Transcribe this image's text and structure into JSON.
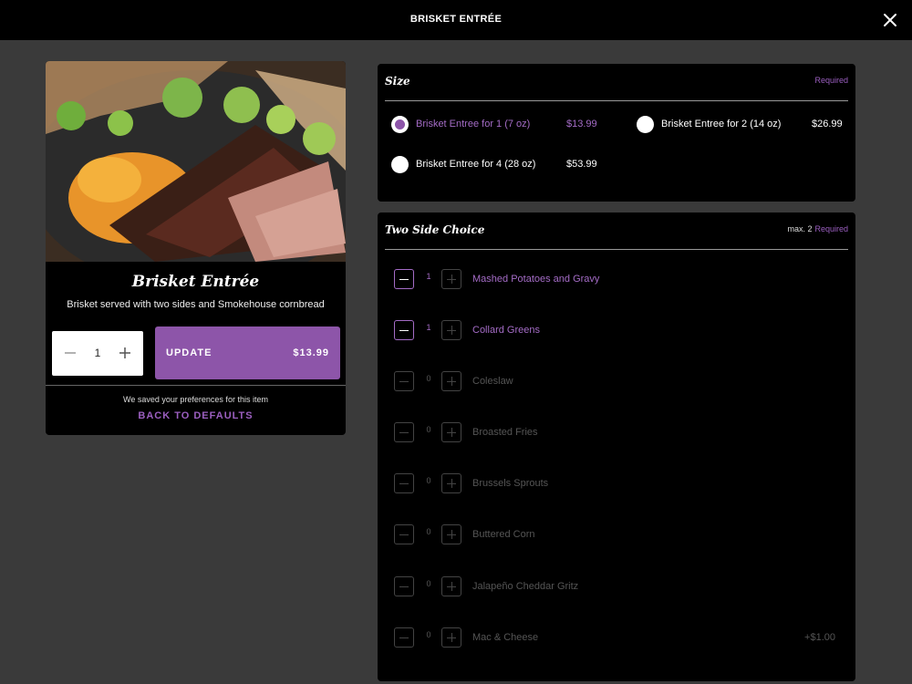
{
  "header": {
    "title": "BRISKET ENTRÉE",
    "close_icon": "close-icon"
  },
  "item": {
    "name": "Brisket Entrée",
    "description": "Brisket served with two sides and Smokehouse cornbread",
    "quantity": "1",
    "update_label": "UPDATE",
    "update_price": "$13.99",
    "saved_text": "We saved your preferences for this item",
    "defaults_label": "BACK TO DEFAULTS"
  },
  "size": {
    "title": "Size",
    "required": "Required",
    "options": [
      {
        "label": "Brisket Entree for 1 (7 oz)",
        "price": "$13.99",
        "selected": true
      },
      {
        "label": "Brisket Entree for 2 (14 oz)",
        "price": "$26.99",
        "selected": false
      },
      {
        "label": "Brisket Entree for 4 (28 oz)",
        "price": "$53.99",
        "selected": false
      }
    ]
  },
  "sides": {
    "title": "Two Side Choice",
    "max": "max. 2",
    "required": "Required",
    "items": [
      {
        "name": "Mashed Potatoes and Gravy",
        "count": "1",
        "extra": ""
      },
      {
        "name": "Collard Greens",
        "count": "1",
        "extra": ""
      },
      {
        "name": "Coleslaw",
        "count": "0",
        "extra": ""
      },
      {
        "name": "Broasted Fries",
        "count": "0",
        "extra": ""
      },
      {
        "name": "Brussels Sprouts",
        "count": "0",
        "extra": ""
      },
      {
        "name": "Buttered Corn",
        "count": "0",
        "extra": ""
      },
      {
        "name": "Jalapeño Cheddar Gritz",
        "count": "0",
        "extra": ""
      },
      {
        "name": "Mac & Cheese",
        "count": "0",
        "extra": "+$1.00"
      }
    ]
  },
  "colors": {
    "accent": "#8d55a9",
    "accent_text": "#a46cc6",
    "panel": "#000000",
    "background": "#3a3a3a"
  }
}
